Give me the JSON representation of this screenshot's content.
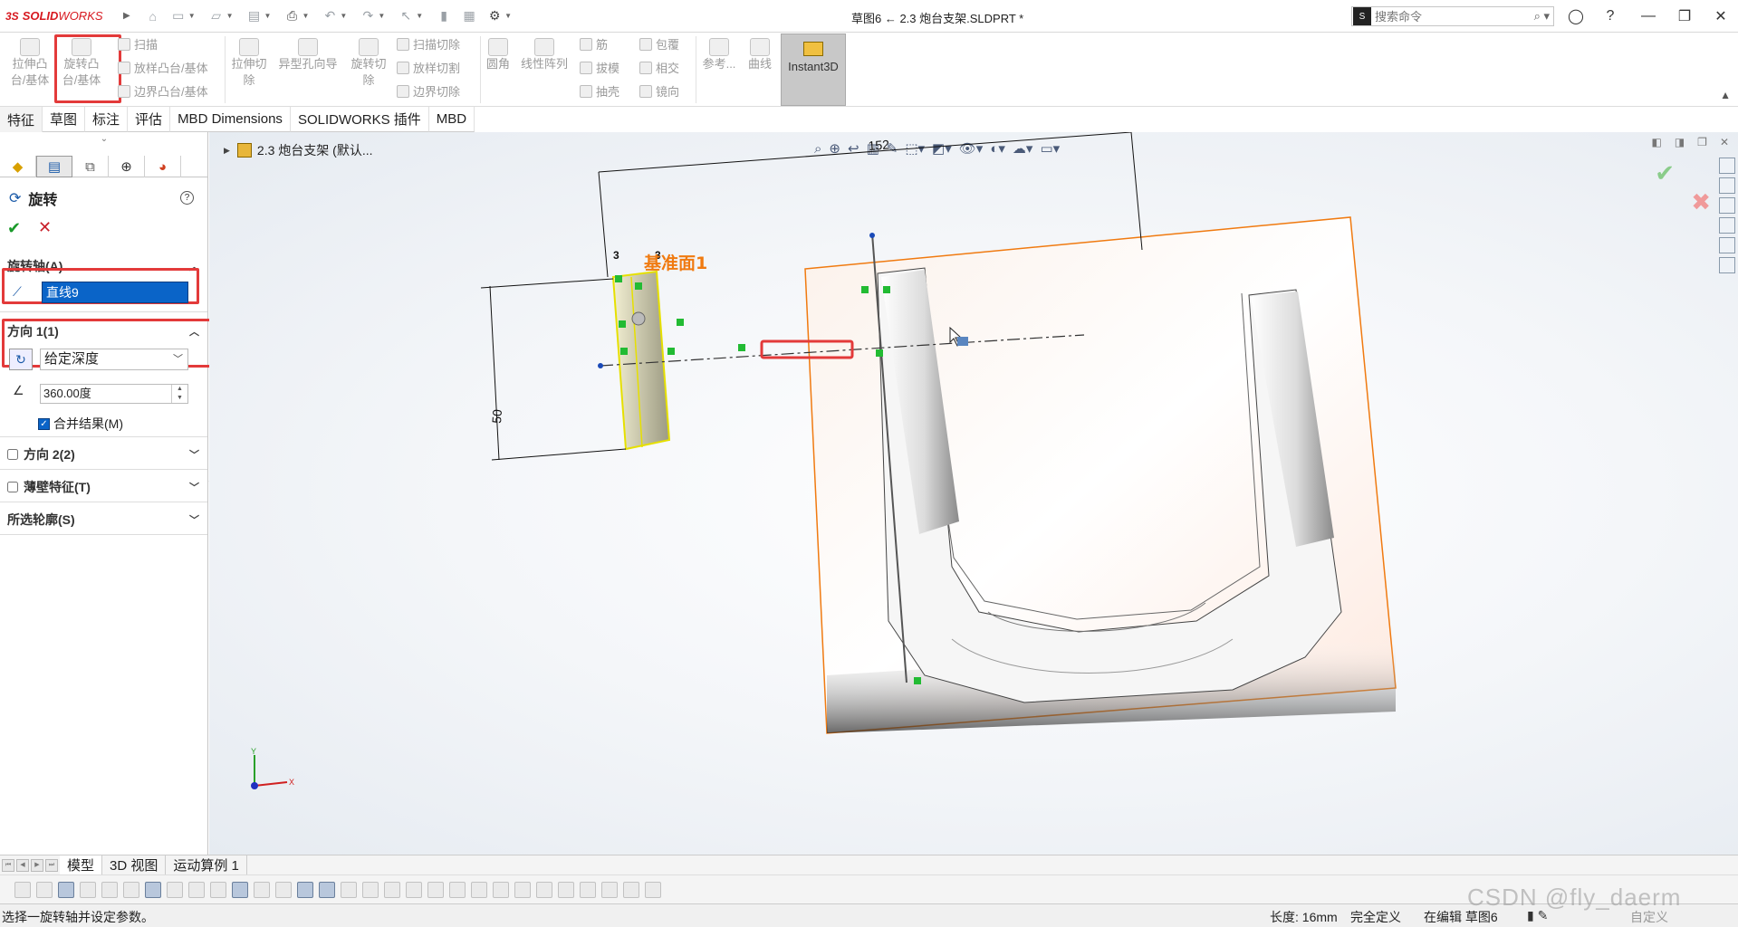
{
  "app": {
    "logo_prefix": "3S",
    "logo_text": "SOLID",
    "logo_text2": "WORKS",
    "doc_title": "草图6 ← 2.3 炮台支架.SLDPRT *",
    "search_placeholder": "搜索命令"
  },
  "ribbon": {
    "extrude_boss": [
      "拉伸凸",
      "台/基体"
    ],
    "revolve_boss": [
      "旋转凸",
      "台/基体"
    ],
    "sweep": "扫描",
    "loft": "放样凸台/基体",
    "boundary": "边界凸台/基体",
    "extrude_cut": [
      "拉伸切",
      "除"
    ],
    "hole_wizard": "异型孔向导",
    "revolve_cut": [
      "旋转切",
      "除"
    ],
    "swept_cut": "扫描切除",
    "lofted_cut": "放样切割",
    "boundary_cut": "边界切除",
    "fillet": "圆角",
    "linear_pattern": "线性阵列",
    "rib": "筋",
    "draft": "拔模",
    "shell": "抽壳",
    "wrap": "包覆",
    "intersect": "相交",
    "mirror": "镜向",
    "reference": "参考...",
    "curves": "曲线",
    "instant3d": "Instant3D"
  },
  "command_tabs": [
    "特征",
    "草图",
    "标注",
    "评估",
    "MBD Dimensions",
    "SOLIDWORKS 插件",
    "MBD"
  ],
  "property_manager": {
    "title": "旋转",
    "help": "?",
    "axis_section": "旋转轴(A)",
    "axis_value": "直线9",
    "direction1_section": "方向 1(1)",
    "direction1_type": "给定深度",
    "angle_value": "360.00度",
    "merge_label": "合并结果(M)",
    "merge_checked": true,
    "direction2_section": "方向 2(2)",
    "thin_feature_section": "薄壁特征(T)",
    "selected_contours_section": "所选轮廓(S)"
  },
  "viewport": {
    "tree_label": "2.3 炮台支架 (默认...",
    "plane_label": "基准面1",
    "dim_overall": "152",
    "dim_height": "50",
    "dim_small_left": "3",
    "dim_small_right": "3",
    "triad_x": "X",
    "triad_y": "Y"
  },
  "bottom_tabs": [
    "模型",
    "3D 视图",
    "运动算例 1"
  ],
  "status": {
    "message": "选择一旋转轴并设定参数。",
    "length": "长度: 16mm",
    "definition": "完全定义",
    "editing": "在编辑 草图6",
    "custom": "自定义"
  },
  "watermark": "CSDN @fly_daerm",
  "colors": {
    "accent_red": "#e33a3a",
    "plane_orange": "#f07a10",
    "selection_blue": "#0a64c8",
    "sketch_green": "#22bb33"
  }
}
